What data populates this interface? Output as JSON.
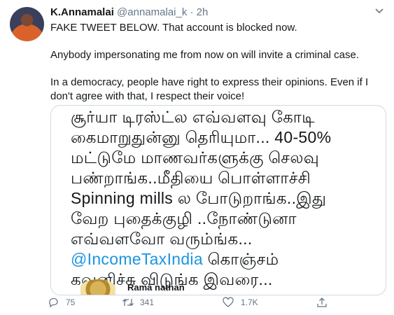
{
  "tweet": {
    "author_name": "K.Annamalai",
    "handle": "@annamalai_k",
    "separator": "·",
    "time": "2h",
    "paragraphs": [
      "FAKE TWEET BELOW. That account is blocked now.",
      "Anybody impersonating me from now on will invite a criminal case.",
      "In a democracy, people have right to express their opinions. Even if I don't agree with that, I respect their voice!"
    ]
  },
  "quoted": {
    "lines": [
      "சூர்யா டிரஸ்ட்ல எவ்வளவு கோடி",
      "கைமாறுதுன்னு தெரியுமா... 40-50%",
      "மட்டுமே மாணவர்களுக்கு செலவு",
      "பண்றாங்க..மீதியை பொள்ளாச்சி",
      "Spinning mills ல போடுறாங்க..இது",
      "வேற புதைக்குழி ..நோண்டுனா",
      "எவ்வளவோ வரும்ங்க..."
    ],
    "mention": "@IncomeTaxIndia",
    "mention_suffix": " கொஞ்சம்",
    "last_line": "கவனிச்சு விடுங்க இவரை...",
    "footer_name": "Rama nathan"
  },
  "actions": {
    "reply_count": "75",
    "retweet_count": "341",
    "like_count": "1.7K"
  },
  "colors": {
    "text": "#14171a",
    "secondary": "#657786",
    "link": "#1b95e0",
    "border": "#cfd9de"
  },
  "icons": [
    "chevron-down-icon",
    "reply-icon",
    "retweet-icon",
    "like-icon",
    "share-icon"
  ]
}
